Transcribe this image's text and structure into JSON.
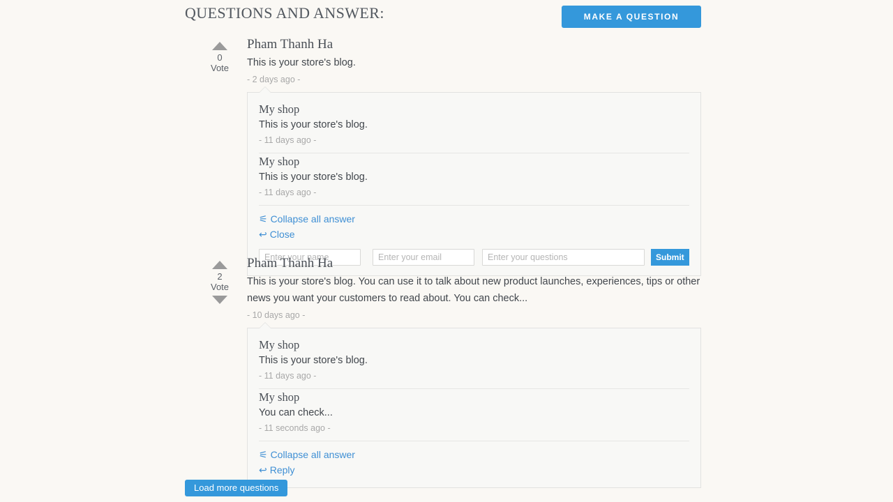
{
  "header": {
    "title": "QUESTIONS AND ANSWER:",
    "make_question_label": "MAKE A QUESTION"
  },
  "colors": {
    "accent": "#3498db",
    "link": "#3f8fd4",
    "page_background": "#faf8f4",
    "box_background": "#f8f8f6",
    "box_border": "#e2e2e0",
    "muted_text": "#a8a8a8"
  },
  "questions": [
    {
      "vote": {
        "count": "0",
        "label": "Vote",
        "up_icon": "triangle-up-icon",
        "has_down": false
      },
      "author": "Pham Thanh Ha",
      "text": "This is your store's blog.",
      "time": "- 2 days ago -",
      "answers": [
        {
          "author": "My shop",
          "text": "This is your store's blog.",
          "time": "- 11 days ago -"
        },
        {
          "author": "My shop",
          "text": "This is your store's blog.",
          "time": "- 11 days ago -"
        }
      ],
      "links": {
        "collapse_label": "Collapse all answer",
        "collapse_icon": "chevron-double-up-icon",
        "action_label": "Close",
        "action_icon": "reply-arrow-icon"
      },
      "form": {
        "visible": true,
        "name_placeholder": "Enter your name",
        "name_value": "",
        "email_placeholder": "Enter your email",
        "email_value": "",
        "question_placeholder": "Enter your questions",
        "question_value": "",
        "submit_label": "Submit"
      }
    },
    {
      "vote": {
        "count": "2",
        "label": "Vote",
        "up_icon": "triangle-up-icon",
        "down_icon": "triangle-down-icon",
        "has_down": true
      },
      "author": "Pham Thanh Ha",
      "text": "This is your store's blog. You can use it to talk about new product launches, experiences, tips or other news you want your customers to read about. You can check...",
      "time": "- 10 days ago -",
      "answers": [
        {
          "author": "My shop",
          "text": "This is your store's blog.",
          "time": "- 11 days ago -"
        },
        {
          "author": "My shop",
          "text": "You can check...",
          "time": "- 11 seconds ago -"
        }
      ],
      "links": {
        "collapse_label": "Collapse all answer",
        "collapse_icon": "chevron-double-up-icon",
        "action_label": "Reply",
        "action_icon": "reply-arrow-icon"
      },
      "form": {
        "visible": false
      }
    }
  ],
  "footer": {
    "load_more_label": "Load more questions"
  }
}
